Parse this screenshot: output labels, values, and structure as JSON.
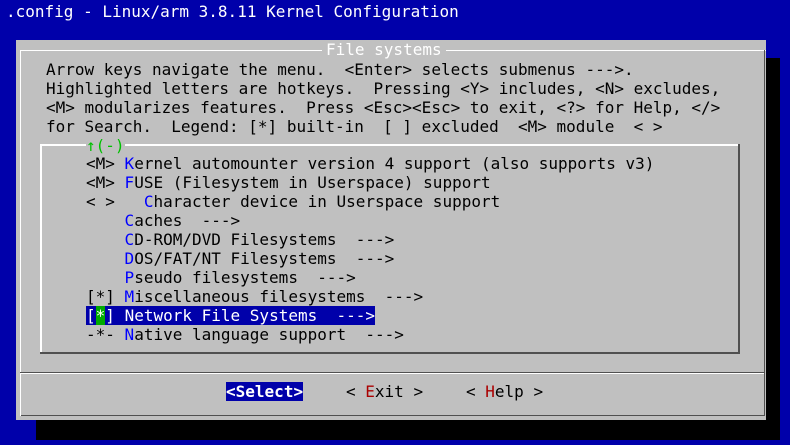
{
  "window": {
    "title": ".config - Linux/arm 3.8.11 Kernel Configuration"
  },
  "dialog": {
    "title": "File systems",
    "help_lines": [
      "Arrow keys navigate the menu.  <Enter> selects submenus --->.",
      "Highlighted letters are hotkeys.  Pressing <Y> includes, <N> excludes,",
      "<M> modularizes features.  Press <Esc><Esc> to exit, <?> for Help, </>",
      "for Search.  Legend: [*] built-in  [ ] excluded  <M> module  < >"
    ],
    "scroll_indicator": "↑(-)",
    "menu_items": [
      {
        "mark": "<M>",
        "pre": " ",
        "hot": "K",
        "rest": "ernel automounter version 4 support (also supports v3)"
      },
      {
        "mark": "<M>",
        "pre": " ",
        "hot": "F",
        "rest": "USE (Filesystem in Userspace) support"
      },
      {
        "mark": "< >",
        "pre": "   ",
        "hot": "C",
        "rest": "haracter device in Userspace support"
      },
      {
        "mark": "   ",
        "pre": " ",
        "hot": "C",
        "rest": "aches  --->"
      },
      {
        "mark": "   ",
        "pre": " ",
        "hot": "C",
        "rest": "D-ROM/DVD Filesystems  --->"
      },
      {
        "mark": "   ",
        "pre": " ",
        "hot": "D",
        "rest": "OS/FAT/NT Filesystems  --->"
      },
      {
        "mark": "   ",
        "pre": " ",
        "hot": "P",
        "rest": "seudo filesystems  --->"
      },
      {
        "mark": "[*]",
        "pre": " ",
        "hot": "M",
        "rest": "iscellaneous filesystems  --->"
      },
      {
        "mark": "[*]",
        "pre": " ",
        "hot": "N",
        "rest": "etwork File Systems  --->",
        "selected": true
      },
      {
        "mark": "-*-",
        "pre": " ",
        "hot": "N",
        "rest": "ative language support  --->"
      }
    ]
  },
  "buttons": {
    "select": {
      "pre": "<",
      "hot": "S",
      "rest": "elect>"
    },
    "exit": {
      "pre": "< ",
      "hot": "E",
      "rest": "xit >"
    },
    "help": {
      "pre": "< ",
      "hot": "H",
      "rest": "elp >"
    }
  }
}
